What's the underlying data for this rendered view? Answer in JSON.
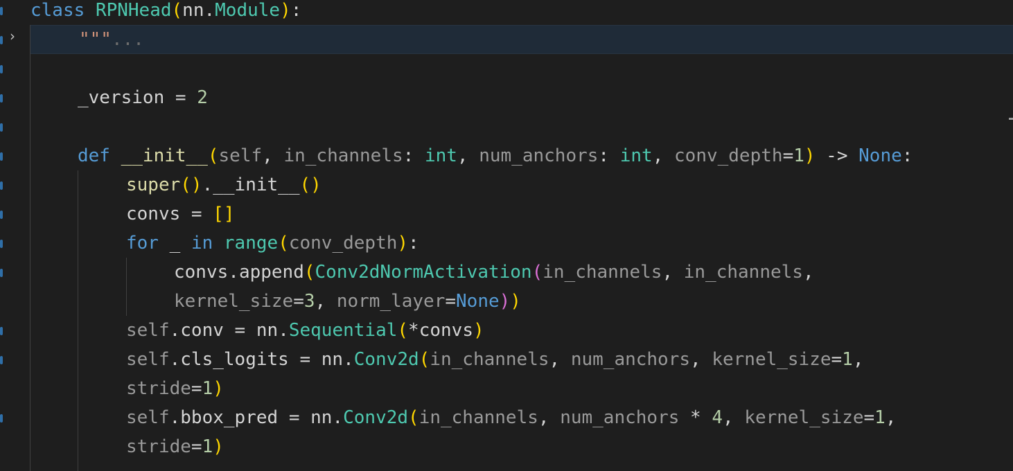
{
  "editor": {
    "folded_docstring": {
      "quotes": "\"\"\"",
      "ellipsis": "..."
    },
    "lines": {
      "l1": {
        "kw": "class",
        "name": "RPNHead",
        "p_open": "(",
        "base_mod": "nn",
        "dot": ".",
        "base_cls": "Module",
        "p_close": ")",
        "colon": ":"
      },
      "l4": {
        "name": "_version",
        "op": " = ",
        "val": "2"
      },
      "l6": {
        "kw": "def",
        "fn": "__init__",
        "p_open": "(",
        "self": "self",
        "sep1": ", ",
        "a1": "in_channels",
        "c1": ": ",
        "t1": "int",
        "sep2": ", ",
        "a2": "num_anchors",
        "c2": ": ",
        "t2": "int",
        "sep3": ", ",
        "a3": "conv_depth",
        "eq": "=",
        "v3": "1",
        "p_close": ")",
        "arrow": " -> ",
        "ret": "None",
        "colon": ":"
      },
      "l7": {
        "fn": "super",
        "p1": "()",
        "dot": ".",
        "init": "__init__",
        "p2": "()"
      },
      "l8": {
        "name": "convs",
        "op": " = ",
        "br": "[]"
      },
      "l9": {
        "kw": "for",
        "sp1": " _ ",
        "kw2": "in",
        "sp2": " ",
        "fn": "range",
        "p_open": "(",
        "arg": "conv_depth",
        "p_close": ")",
        "colon": ":"
      },
      "l10": {
        "obj": "convs",
        "dot": ".",
        "meth": "append",
        "p_open": "(",
        "cls": "Conv2dNormActivation",
        "p2_open": "(",
        "a1": "in_channels",
        "sep": ", ",
        "a2": "in_channels",
        "trail": ","
      },
      "l11": {
        "k1": "kernel_size",
        "eq1": "=",
        "v1": "3",
        "sep": ", ",
        "k2": "norm_layer",
        "eq2": "=",
        "v2": "None",
        "p2_close": ")",
        "p_close": ")"
      },
      "l12": {
        "self": "self",
        "attr": ".conv",
        "op": " = ",
        "mod": "nn",
        "dot": ".",
        "cls": "Sequential",
        "p_open": "(",
        "arg": "*convs",
        "p_close": ")"
      },
      "l13": {
        "self": "self",
        "attr": ".cls_logits",
        "op": " = ",
        "mod": "nn",
        "dot": ".",
        "cls": "Conv2d",
        "p_open": "(",
        "a1": "in_channels",
        "sep1": ", ",
        "a2": "num_anchors",
        "sep2": ", ",
        "k": "kernel_size",
        "eq": "=",
        "v": "1",
        "trail": ","
      },
      "l14": {
        "k": "stride",
        "eq": "=",
        "v": "1",
        "p_close": ")"
      },
      "l15": {
        "self": "self",
        "attr": ".bbox_pred",
        "op": " = ",
        "mod": "nn",
        "dot": ".",
        "cls": "Conv2d",
        "p_open": "(",
        "a1": "in_channels",
        "sep1": ", ",
        "a2": "num_anchors",
        "mul": " * ",
        "n": "4",
        "sep2": ", ",
        "k": "kernel_size",
        "eq": "=",
        "v": "1",
        "trail": ","
      },
      "l16": {
        "k": "stride",
        "eq": "=",
        "v": "1",
        "p_close": ")"
      }
    }
  }
}
